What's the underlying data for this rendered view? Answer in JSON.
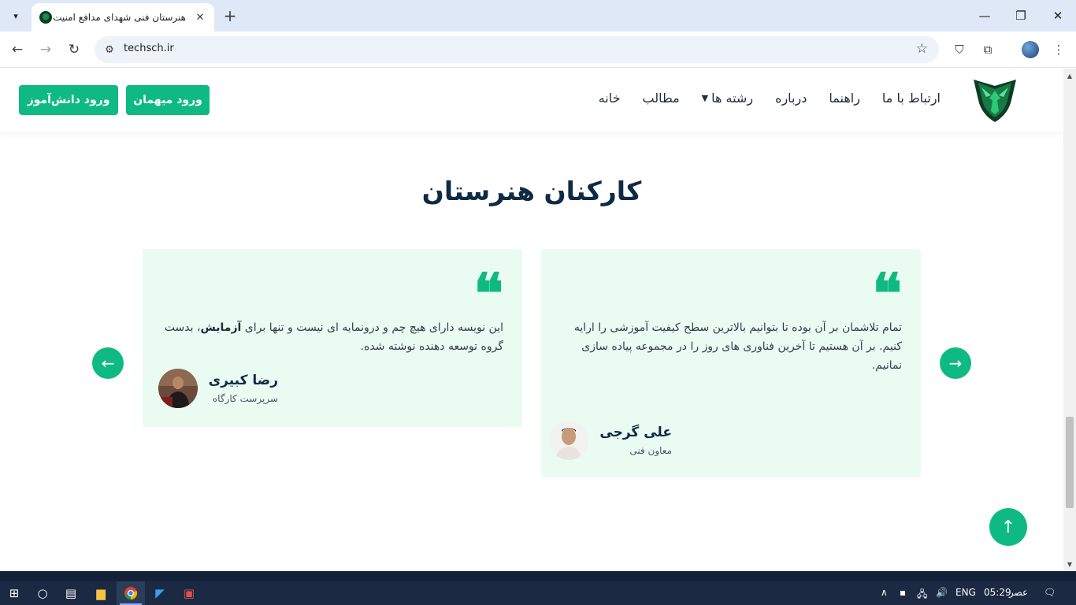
{
  "browser": {
    "tab_title": "هنرستان فنی شهدای مدافع امنیت",
    "url": "techsch.ir",
    "new_tab": "+",
    "tab_close": "✕"
  },
  "header": {
    "menu": [
      {
        "label": "خانه"
      },
      {
        "label": "مطالب"
      },
      {
        "label": "رشته ها",
        "has_dropdown": true
      },
      {
        "label": "درباره"
      },
      {
        "label": "راهنما"
      },
      {
        "label": "ارتباط با ما"
      }
    ],
    "guest_login": "ورود میهمان",
    "student_login": "ورود دانش‌آموز"
  },
  "section": {
    "title": "کارکنان هنرستان"
  },
  "testimonials": [
    {
      "text": "تمام تلاشمان بر آن بوده تا بتوانیم بالاترین سطح کیفیت آموزشی را ارایه کنیم. بر آن هستیم تا آخرین فناوری های روز را در مجموعه پیاده سازی نمانیم.",
      "name": "علی گرجی",
      "role": "معاون فنی"
    },
    {
      "text_before": "این نویسه دارای هیچ چم و درونمایه ای نیست و تنها برای ",
      "text_bold": "آزمایش",
      "text_after": "، بدست گروه توسعه دهنده نوشته شده.",
      "name": "رضا کبیری",
      "role": "سرپرست کارگاه"
    }
  ],
  "taskbar": {
    "language": "ENG",
    "time": "05:29",
    "period": "عصر"
  },
  "colors": {
    "accent": "#0fba82",
    "card_bg": "#eafcf2",
    "heading": "#0f2a44"
  }
}
